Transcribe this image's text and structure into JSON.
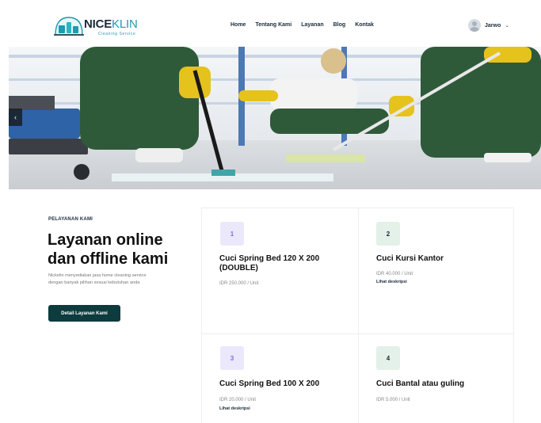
{
  "brand": {
    "name_part1": "NICE",
    "name_part2": "KLIN",
    "tagline": "Cleaning Service"
  },
  "nav": {
    "items": [
      "Home",
      "Tentang Kami",
      "Layanan",
      "Blog",
      "Kontak"
    ]
  },
  "user": {
    "name": "Jarwo",
    "dropdown_icon": "chevron-down-icon"
  },
  "hero": {
    "prev_icon": "chevron-left-icon"
  },
  "intro": {
    "eyebrow": "PELAYANAN KAMI",
    "headline_line1": "Layanan online",
    "headline_line2": "dan offline kami",
    "desc_line1": "Nickelin menyediakan jasa home cleaning service",
    "desc_line2": "dengan banyak pilihan sesuai kebutuhan anda",
    "cta_label": "Detail Layanan Kami"
  },
  "services": [
    {
      "num": "1",
      "title_line1": "Cuci Spring Bed 120 X 200",
      "title_line2": "(DOUBLE)",
      "price": "IDR 250.000 / Unit",
      "link": "",
      "badge_color": "purple"
    },
    {
      "num": "2",
      "title_line1": "Cuci Kursi Kantor",
      "title_line2": "",
      "price": "IDR 40.000 / Unit",
      "link": "Lihat deskripsi",
      "badge_color": "green"
    },
    {
      "num": "3",
      "title_line1": "Cuci Spring Bed 100 X 200",
      "title_line2": "",
      "price": "IDR 20.000 / Unit",
      "link": "Lihat deskripsi",
      "badge_color": "purple"
    },
    {
      "num": "4",
      "title_line1": "Cuci Bantal atau guling",
      "title_line2": "",
      "price": "IDR 5.000 / Unit",
      "link": "",
      "badge_color": "green"
    }
  ],
  "colors": {
    "brand_dark": "#1b2b3a",
    "brand_teal": "#1b9cb0",
    "cta": "#0d3b3e",
    "badge_purple": "#ebe8fb",
    "badge_green": "#e3f1e8"
  }
}
